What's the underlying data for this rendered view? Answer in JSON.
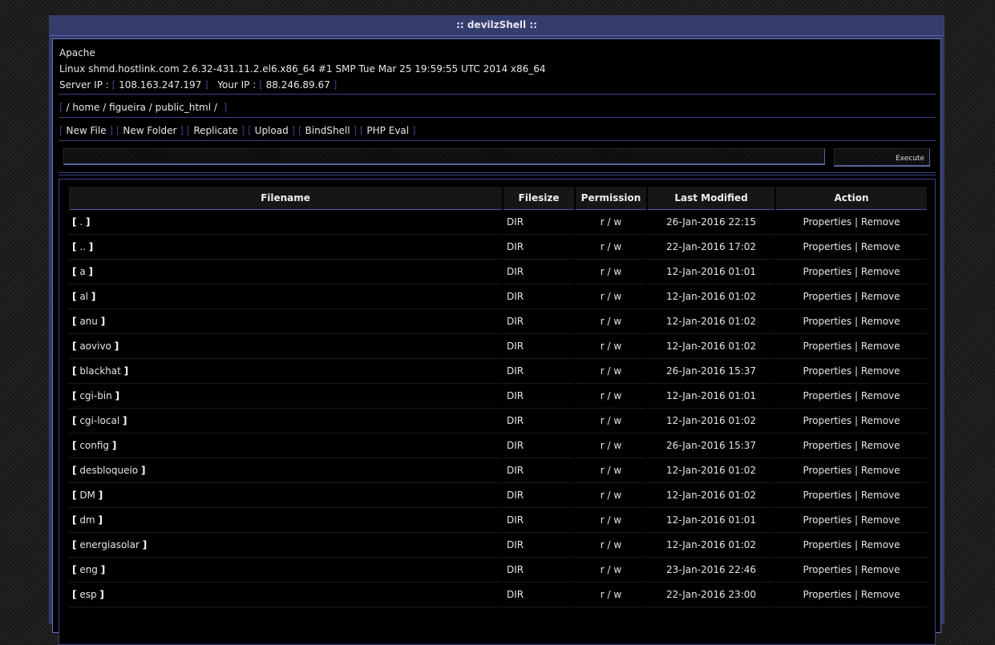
{
  "window": {
    "title": ":: devilzShell ::"
  },
  "info": {
    "server_software": "Apache",
    "uname": "Linux shmd.hostlink.com 2.6.32-431.11.2.el6.x86_64 #1 SMP Tue Mar 25 19:59:55 UTC 2014 x86_64",
    "server_ip_label": "Server IP :",
    "server_ip": "108.163.247.197",
    "your_ip_label": "Your IP :",
    "your_ip": "88.246.89.67"
  },
  "path": {
    "segments": [
      "/",
      "home",
      "/",
      "figueira",
      "/",
      "public_html",
      "/"
    ]
  },
  "menu": [
    "New File",
    "New Folder",
    "Replicate",
    "Upload",
    "BindShell",
    "PHP Eval"
  ],
  "command": {
    "value": "",
    "execute_label": "Execute"
  },
  "table": {
    "headers": [
      "Filename",
      "Filesize",
      "Permission",
      "Last Modified",
      "Action"
    ],
    "properties_label": "Properties",
    "action_sep": "|",
    "remove_label": "Remove",
    "rows": [
      {
        "name": ".",
        "size": "DIR",
        "perm": "r / w",
        "modified": "26-Jan-2016 22:15"
      },
      {
        "name": "..",
        "size": "DIR",
        "perm": "r / w",
        "modified": "22-Jan-2016 17:02"
      },
      {
        "name": "a",
        "size": "DIR",
        "perm": "r / w",
        "modified": "12-Jan-2016 01:01"
      },
      {
        "name": "al",
        "size": "DIR",
        "perm": "r / w",
        "modified": "12-Jan-2016 01:02"
      },
      {
        "name": "anu",
        "size": "DIR",
        "perm": "r / w",
        "modified": "12-Jan-2016 01:02"
      },
      {
        "name": "aovivo",
        "size": "DIR",
        "perm": "r / w",
        "modified": "12-Jan-2016 01:02"
      },
      {
        "name": "blackhat",
        "size": "DIR",
        "perm": "r / w",
        "modified": "26-Jan-2016 15:37"
      },
      {
        "name": "cgi-bin",
        "size": "DIR",
        "perm": "r / w",
        "modified": "12-Jan-2016 01:01"
      },
      {
        "name": "cgi-local",
        "size": "DIR",
        "perm": "r / w",
        "modified": "12-Jan-2016 01:02"
      },
      {
        "name": "config",
        "size": "DIR",
        "perm": "r / w",
        "modified": "26-Jan-2016 15:37"
      },
      {
        "name": "desbloqueio",
        "size": "DIR",
        "perm": "r / w",
        "modified": "12-Jan-2016 01:02"
      },
      {
        "name": "DM",
        "size": "DIR",
        "perm": "r / w",
        "modified": "12-Jan-2016 01:02"
      },
      {
        "name": "dm",
        "size": "DIR",
        "perm": "r / w",
        "modified": "12-Jan-2016 01:01"
      },
      {
        "name": "energiasolar",
        "size": "DIR",
        "perm": "r / w",
        "modified": "12-Jan-2016 01:02"
      },
      {
        "name": "eng",
        "size": "DIR",
        "perm": "r / w",
        "modified": "23-Jan-2016 22:46"
      },
      {
        "name": "esp",
        "size": "DIR",
        "perm": "r / w",
        "modified": "22-Jan-2016 23:00"
      }
    ]
  }
}
